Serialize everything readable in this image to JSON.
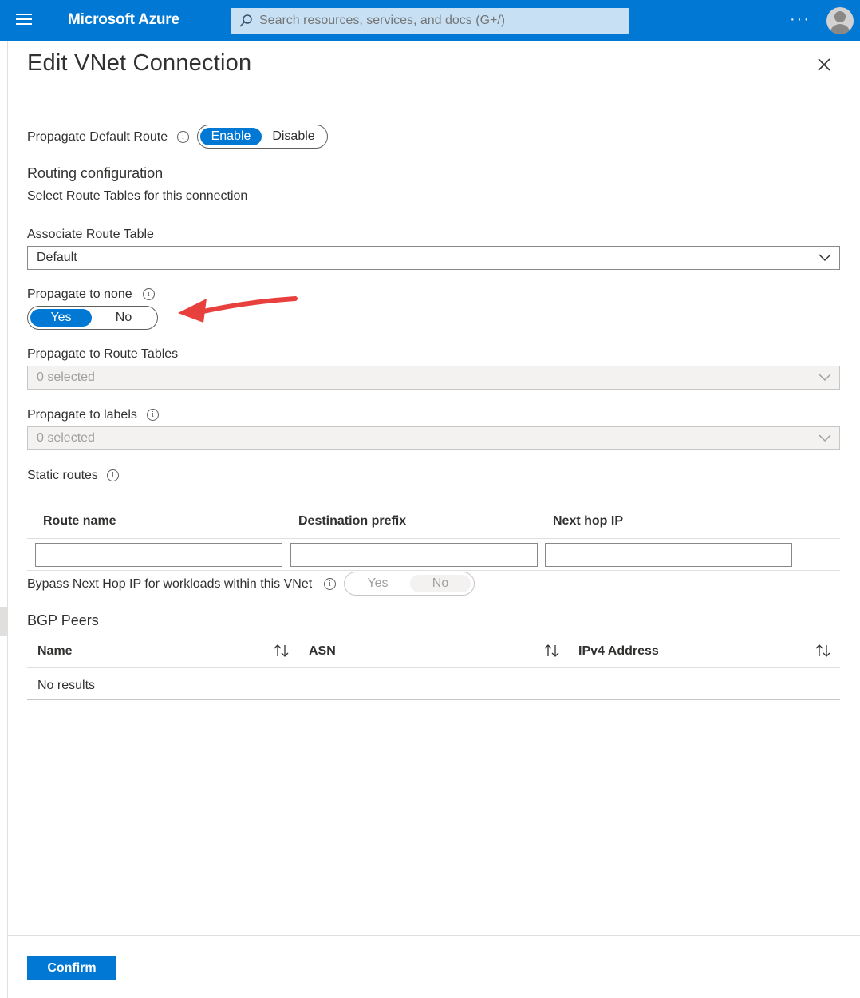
{
  "topbar": {
    "brand": "Microsoft Azure",
    "search_placeholder": "Search resources, services, and docs (G+/)",
    "more_label": "···",
    "accent_color": "#0078d4"
  },
  "panel": {
    "title": "Edit VNet Connection",
    "propagate_default_route": {
      "label": "Propagate Default Route",
      "options": [
        "Enable",
        "Disable"
      ],
      "selected": "Enable"
    },
    "routing": {
      "heading": "Routing configuration",
      "subheading": "Select Route Tables for this connection"
    },
    "associate_route_table": {
      "label": "Associate Route Table",
      "value": "Default"
    },
    "propagate_to_none": {
      "label": "Propagate to none",
      "options": [
        "Yes",
        "No"
      ],
      "selected": "Yes"
    },
    "propagate_to_route_tables": {
      "label": "Propagate to Route Tables",
      "value": "0 selected"
    },
    "propagate_to_labels": {
      "label": "Propagate to labels",
      "value": "0 selected"
    },
    "static_routes": {
      "label": "Static routes",
      "columns": [
        "Route name",
        "Destination prefix",
        "Next hop IP"
      ]
    },
    "bypass_next_hop": {
      "label": "Bypass Next Hop IP for workloads within this VNet",
      "options": [
        "Yes",
        "No"
      ],
      "selected": "No"
    },
    "bgp_peers": {
      "heading": "BGP Peers",
      "columns": [
        "Name",
        "ASN",
        "IPv4 Address"
      ],
      "empty_text": "No results"
    },
    "confirm_label": "Confirm"
  }
}
